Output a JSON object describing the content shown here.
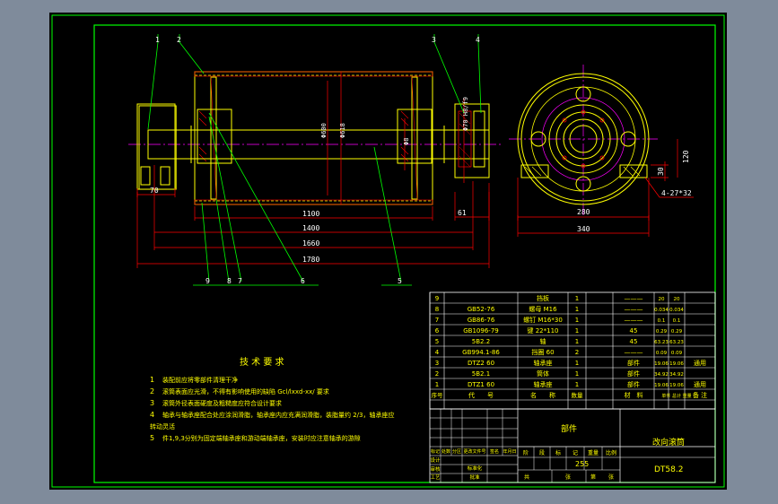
{
  "colors": {
    "background": "#7f8b9b",
    "frame": "#00ff00",
    "part": "#ffff00",
    "dimension": "#ff0000",
    "centerline": "#ff00ff",
    "table": "#ffffff"
  },
  "balloons": [
    "1",
    "2",
    "3",
    "4",
    "9",
    "8",
    "7",
    "6",
    "5"
  ],
  "dimensions": {
    "d70": "70",
    "d1100": "1100",
    "d1400": "1400",
    "d1660": "1660",
    "d1780": "1780",
    "d61": "61",
    "d280": "280",
    "d340": "340",
    "d30": "30",
    "d120": "120",
    "holes": "4-27*32",
    "dia600": "Φ600",
    "dia618": "Φ618",
    "dia_shaft": "Φ70 H8/f9",
    "dia_bore": "Φ8"
  },
  "notes": {
    "title": "技 术 要 求",
    "lines": [
      {
        "num": "1",
        "text": "装配前应将零部件清理干净"
      },
      {
        "num": "2",
        "text": "滚筒表面应光滑，不得有影响使用的缺陷 Gcl/lxxd-xx/ 要求"
      },
      {
        "num": "3",
        "text": "滚筒外径表面硬度及粗糙度应符合设计要求"
      },
      {
        "num": "4",
        "text": "轴承与轴承座配合处应涂润滑脂，轴承座内应充满润滑脂，装脂量约 2/3，轴承座应"
      },
      {
        "num": "",
        "text": "转动灵活"
      },
      {
        "num": "5",
        "text": "件1,9,3分别为固定端轴承座和游动端轴承座，安装时应注意轴承的游隙"
      }
    ]
  },
  "bom": {
    "rows": [
      {
        "no": "9",
        "code": "",
        "name": "挡板",
        "qty": "1",
        "mat": "———",
        "w1": "20",
        "w2": "20",
        "note": ""
      },
      {
        "no": "8",
        "code": "GB52-76",
        "name": "螺母 M16",
        "qty": "1",
        "mat": "———",
        "w1": "0.034",
        "w2": "0.034",
        "note": ""
      },
      {
        "no": "7",
        "code": "GB86-76",
        "name": "螺钉 M16*30",
        "qty": "1",
        "mat": "———",
        "w1": "0.1",
        "w2": "0.1",
        "note": ""
      },
      {
        "no": "6",
        "code": "GB1096-79",
        "name": "键 22*110",
        "qty": "1",
        "mat": "45",
        "w1": "0.29",
        "w2": "0.29",
        "note": ""
      },
      {
        "no": "5",
        "code": "5B2.2",
        "name": "轴",
        "qty": "1",
        "mat": "45",
        "w1": "63.23",
        "w2": "63.23",
        "note": ""
      },
      {
        "no": "4",
        "code": "GB994.1-86",
        "name": "挡圈 60",
        "qty": "2",
        "mat": "———",
        "w1": "0.09",
        "w2": "0.09",
        "note": ""
      },
      {
        "no": "3",
        "code": "DTZ2 60",
        "name": "轴承座",
        "qty": "1",
        "mat": "部件",
        "w1": "19.06",
        "w2": "19.06",
        "note": "通用"
      },
      {
        "no": "2",
        "code": "5B2.1",
        "name": "筒体",
        "qty": "1",
        "mat": "部件",
        "w1": "34.92",
        "w2": "34.92",
        "note": ""
      },
      {
        "no": "1",
        "code": "DTZ1 60",
        "name": "轴承座",
        "qty": "1",
        "mat": "部件",
        "w1": "19.06",
        "w2": "19.06",
        "note": "通用"
      }
    ],
    "header": {
      "no": "序号",
      "code": "代　　号",
      "name": "名　　称",
      "qty": "数量",
      "mat": "材　料",
      "weight": "单件 总计 重量",
      "note": "备 注"
    }
  },
  "title_block": {
    "part_label": "部件",
    "drawing_name": "改向滚筒",
    "drawing_no": "DT58.2",
    "mass": "255",
    "revision_headers": [
      "标记",
      "处数",
      "分区",
      "更改文件号",
      "签名",
      "年月日"
    ],
    "stage_headers": [
      "阶",
      "段",
      "标",
      "记",
      "重量",
      "比例"
    ],
    "sheet_headers": [
      "共",
      "张",
      "第",
      "张"
    ],
    "roles": [
      "设计",
      "标准化",
      "审核",
      "工艺",
      "批准"
    ]
  }
}
